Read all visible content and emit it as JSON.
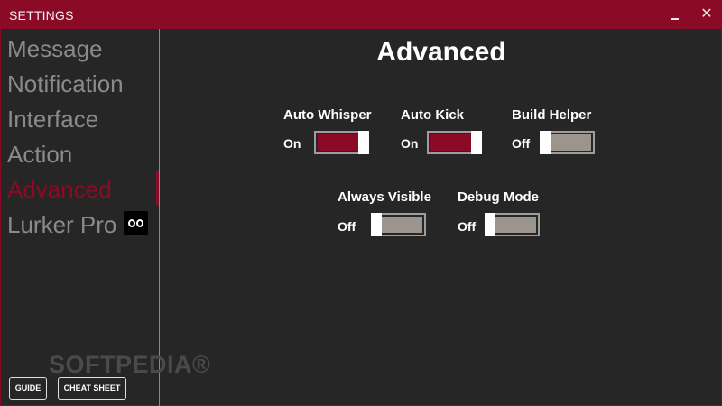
{
  "window": {
    "title": "SETTINGS",
    "minimize_label": "",
    "close_label": "✕"
  },
  "sidebar": {
    "items": [
      {
        "label": "Message"
      },
      {
        "label": "Notification"
      },
      {
        "label": "Interface"
      },
      {
        "label": "Action"
      },
      {
        "label": "Advanced",
        "active": true
      },
      {
        "label": "Lurker Pro"
      }
    ],
    "buttons": {
      "guide": "GUIDE",
      "cheat_sheet": "CHEAT SHEET"
    }
  },
  "main": {
    "heading": "Advanced",
    "options": [
      {
        "label": "Auto Whisper",
        "state": "On"
      },
      {
        "label": "Auto Kick",
        "state": "On"
      },
      {
        "label": "Build Helper",
        "state": "Off"
      },
      {
        "label": "Always Visible",
        "state": "Off"
      },
      {
        "label": "Debug Mode",
        "state": "Off"
      }
    ]
  },
  "colors": {
    "accent": "#8b0a26",
    "background": "#262626",
    "toggle_off_fill": "#9b958e",
    "inactive_text": "#8a8a8a"
  },
  "watermark": "SOFTPEDIA®"
}
